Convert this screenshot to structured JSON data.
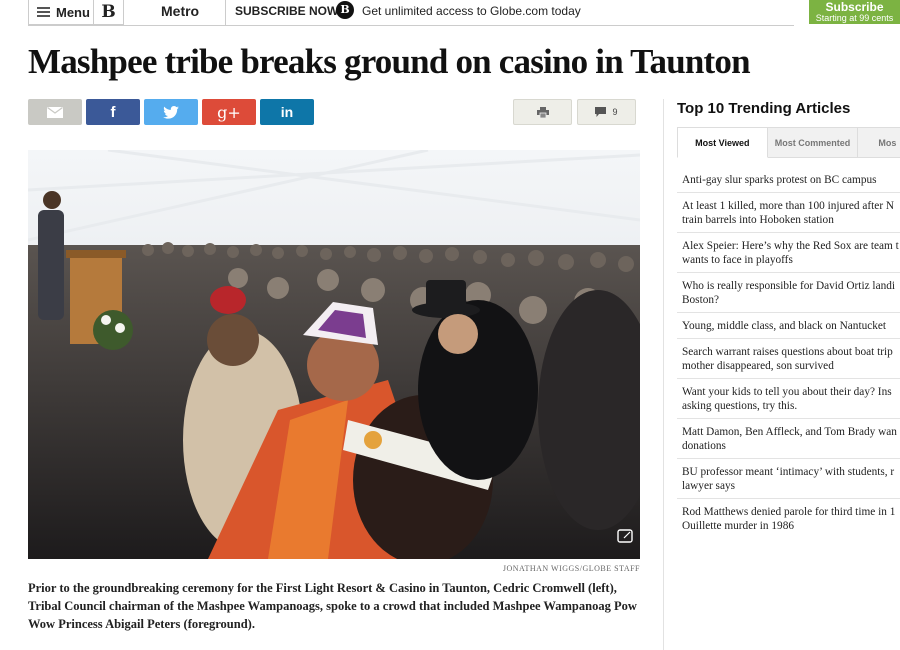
{
  "topbar": {
    "menu_label": "Menu",
    "logo_glyph": "B",
    "section": "Metro",
    "subscribe_now": "SUBSCRIBE NOW",
    "subscribe_logo_glyph": "B",
    "subscribe_text": "Get unlimited access to Globe.com today",
    "subscribe_button_line1": "Subscribe",
    "subscribe_button_line2": "Starting at 99 cents"
  },
  "article": {
    "headline": "Mashpee tribe breaks ground on casino in Taunton",
    "comment_count": "9",
    "photo_credit": "JONATHAN WIGGS/GLOBE STAFF",
    "caption": "Prior to the groundbreaking ceremony for the First Light Resort & Casino in Taunton, Cedric Cromwell (left), Tribal Council chairman of the Mashpee Wampanoags, spoke to a crowd that included Mashpee Wampanoag Pow Wow Princess Abigail Peters (foreground)."
  },
  "share": {
    "facebook_glyph": "f",
    "googleplus_glyph": "g+",
    "linkedin_glyph": "in"
  },
  "colors": {
    "facebook": "#3b5998",
    "twitter": "#55acee",
    "googleplus": "#dd4b39",
    "linkedin": "#0e76a8",
    "subscribe": "#7cb342"
  },
  "icons": [
    "hamburger-icon",
    "email-icon",
    "twitter-bird-icon",
    "print-icon",
    "comment-icon",
    "photo-expand-icon"
  ],
  "sidebar": {
    "title": "Top 10 Trending Articles",
    "tabs": [
      "Most Viewed",
      "Most Commented",
      "Mos"
    ],
    "items": [
      {
        "l1": "Anti-gay slur sparks protest on BC campus",
        "l2": ""
      },
      {
        "l1": "At least 1 killed, more than 100 injured after N",
        "l2": "train barrels into Hoboken station"
      },
      {
        "l1": "Alex Speier: Here’s why the Red Sox are team t",
        "l2": "wants to face in playoffs"
      },
      {
        "l1": "Who is really responsible for David Ortiz landi",
        "l2": "Boston?"
      },
      {
        "l1": "Young, middle class, and black on Nantucket",
        "l2": ""
      },
      {
        "l1": "Search warrant raises questions about boat trip",
        "l2": "mother disappeared, son survived"
      },
      {
        "l1": "Want your kids to tell you about their day? Ins",
        "l2": "asking questions, try this."
      },
      {
        "l1": "Matt Damon, Ben Affleck, and Tom Brady wan",
        "l2": "donations"
      },
      {
        "l1": "BU professor meant ‘intimacy’ with students, r",
        "l2": "lawyer says"
      },
      {
        "l1": "Rod Matthews denied parole for third time in 1",
        "l2": "Ouillette murder in 1986"
      }
    ]
  }
}
